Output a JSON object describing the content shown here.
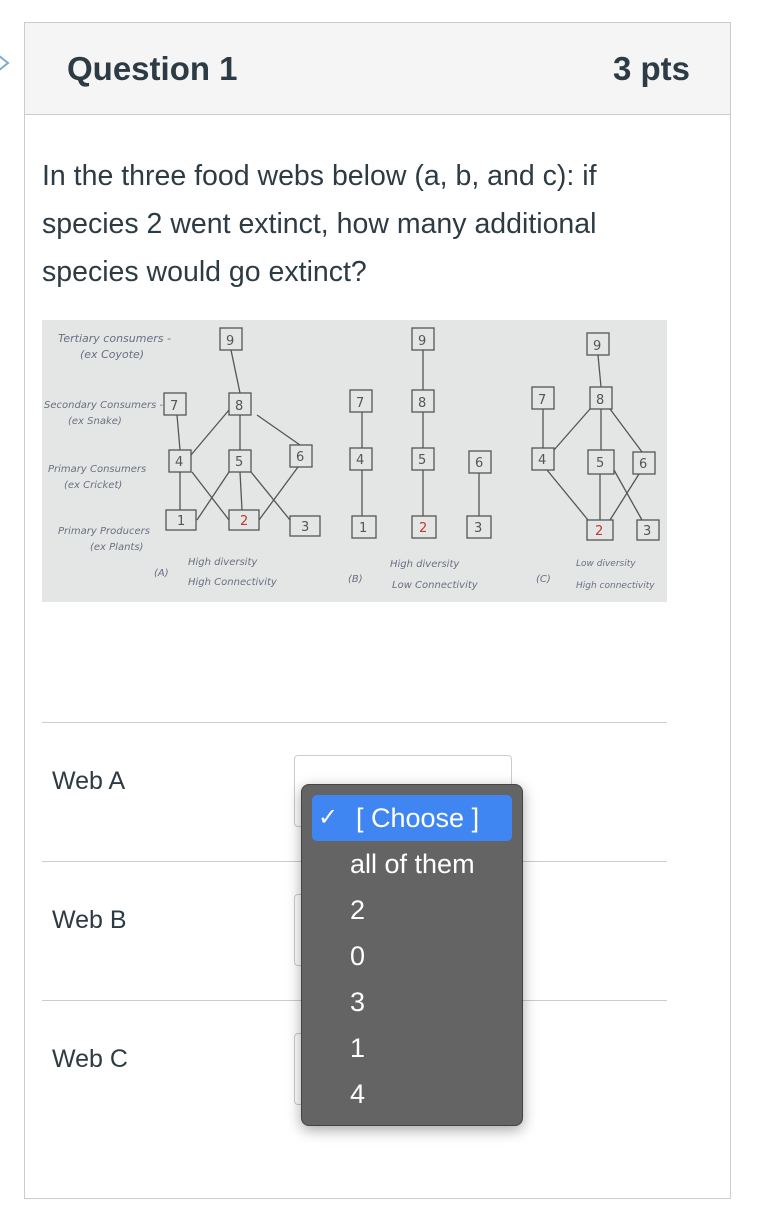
{
  "question": {
    "title": "Question 1",
    "points": "3 pts",
    "text": "In the three food webs below (a, b, and c):  if species 2 went extinct, how many additional species would go extinct?"
  },
  "figure": {
    "trophic_levels": [
      {
        "name": "Tertiary consumers -",
        "example": "(ex Coyote)"
      },
      {
        "name": "Secondary Consumers -",
        "example": "(ex Snake)"
      },
      {
        "name": "Primary Consumers",
        "example": "(ex Cricket)"
      },
      {
        "name": "Primary Producers",
        "example": "(ex Plants)"
      }
    ],
    "webs": [
      {
        "letter": "(A)",
        "diversity": "High diversity",
        "connectivity": "High Connectivity"
      },
      {
        "letter": "(B)",
        "diversity": "High diversity",
        "connectivity": "Low Connectivity"
      },
      {
        "letter": "(C)",
        "diversity": "Low diversity",
        "connectivity": "High connectivity"
      }
    ],
    "species_numbers": [
      "1",
      "2",
      "3",
      "4",
      "5",
      "6",
      "7",
      "8",
      "9"
    ]
  },
  "answers": [
    {
      "label": "Web A"
    },
    {
      "label": "Web B"
    },
    {
      "label": "Web C"
    }
  ],
  "dropdown": {
    "selected": "[ Choose ]",
    "options": [
      "all of them",
      "2",
      "0",
      "3",
      "1",
      "4"
    ],
    "check_icon": "checkmark-icon",
    "selected_color": "#3f86f2"
  }
}
